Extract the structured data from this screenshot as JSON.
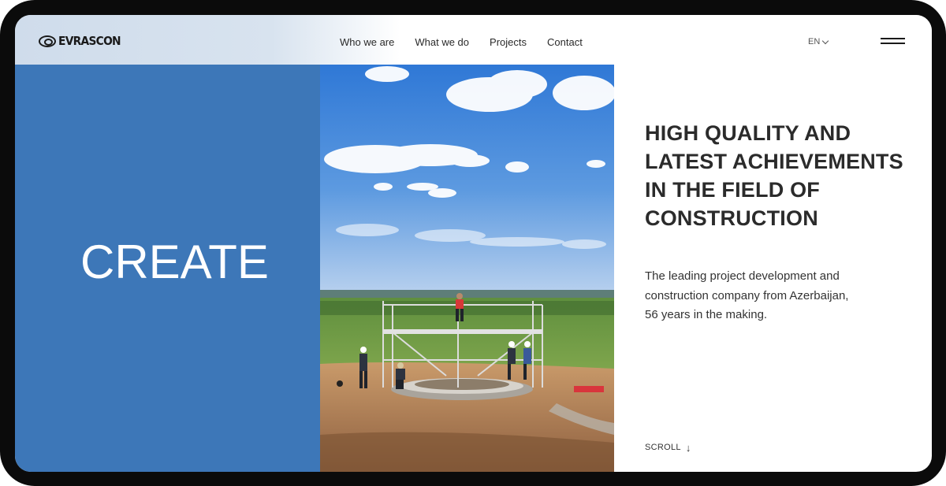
{
  "header": {
    "logo_text": "EVRASCON",
    "nav": [
      "Who we are",
      "What we do",
      "Projects",
      "Contact"
    ],
    "language": "EN"
  },
  "hero": {
    "word": "CREATE",
    "headline_lines": [
      "HIGH QUALITY AND",
      "LATEST ACHIEVEMENTS",
      "IN THE FIELD OF",
      "CONSTRUCTION"
    ],
    "description_lines": [
      "The leading project development and",
      "construction company from Azerbaijan,",
      "56 years in the making."
    ],
    "scroll_label": "SCROLL",
    "scroll_arrow": "↓"
  },
  "colors": {
    "brand_blue": "#3d77b8",
    "text_dark": "#2b2b2b",
    "frame": "#0b0b0b"
  },
  "icons": [
    "logo-icon",
    "chevron-down-icon",
    "menu-icon",
    "arrow-down-icon"
  ]
}
